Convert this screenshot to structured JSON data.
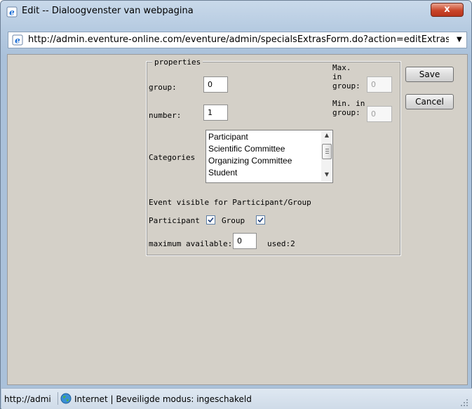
{
  "window": {
    "title": "Edit -- Dialoogvenster van webpagina",
    "close_label": "x",
    "address": "http://admin.eventure-online.com/eventure/admin/specialsExtrasForm.do?action=editExtras&t"
  },
  "form": {
    "legend": "properties",
    "group_label": "group:",
    "group_value": "0",
    "number_label": "number:",
    "number_value": "1",
    "max_in_group_label_1": "Max.",
    "max_in_group_label_2": "in",
    "max_in_group_label_3": "group:",
    "max_in_group_value": "0",
    "min_in_group_label_1": "Min. in",
    "min_in_group_label_2": "group:",
    "min_in_group_value": "0",
    "categories_label": "Categories",
    "categories": [
      "Participant",
      "Scientific Committee",
      "Organizing Committee",
      "Student"
    ],
    "visible_heading": "Event visible for Participant/Group",
    "participant_label": "Participant",
    "participant_checked": true,
    "group_check_label": "Group",
    "group_checked": true,
    "max_available_label": "maximum available:",
    "max_available_value": "0",
    "used_label": "used:2"
  },
  "buttons": {
    "save": "Save",
    "cancel": "Cancel"
  },
  "statusbar": {
    "url": "http://admi",
    "zone": "Internet | Beveiligde modus: ingeschakeld"
  }
}
